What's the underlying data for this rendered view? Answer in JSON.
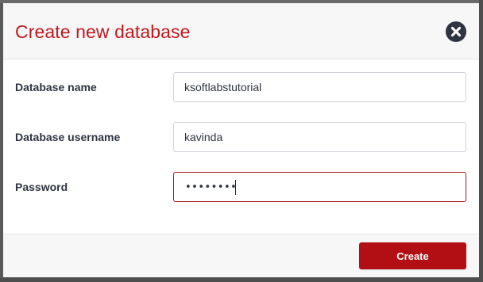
{
  "dialog": {
    "title": "Create new database",
    "close_icon": "close-circle-icon"
  },
  "form": {
    "database_name": {
      "label": "Database name",
      "value": "ksoftlabstutorial"
    },
    "database_username": {
      "label": "Database username",
      "value": "kavinda"
    },
    "password": {
      "label": "Password",
      "masked_value": "••••••••",
      "focused": true
    }
  },
  "footer": {
    "create_label": "Create"
  },
  "colors": {
    "title": "#c0191e",
    "primary_button": "#b20f14",
    "focus_border": "#a8161b",
    "label_text": "#2f3441",
    "close_icon_bg": "#2f3441"
  }
}
